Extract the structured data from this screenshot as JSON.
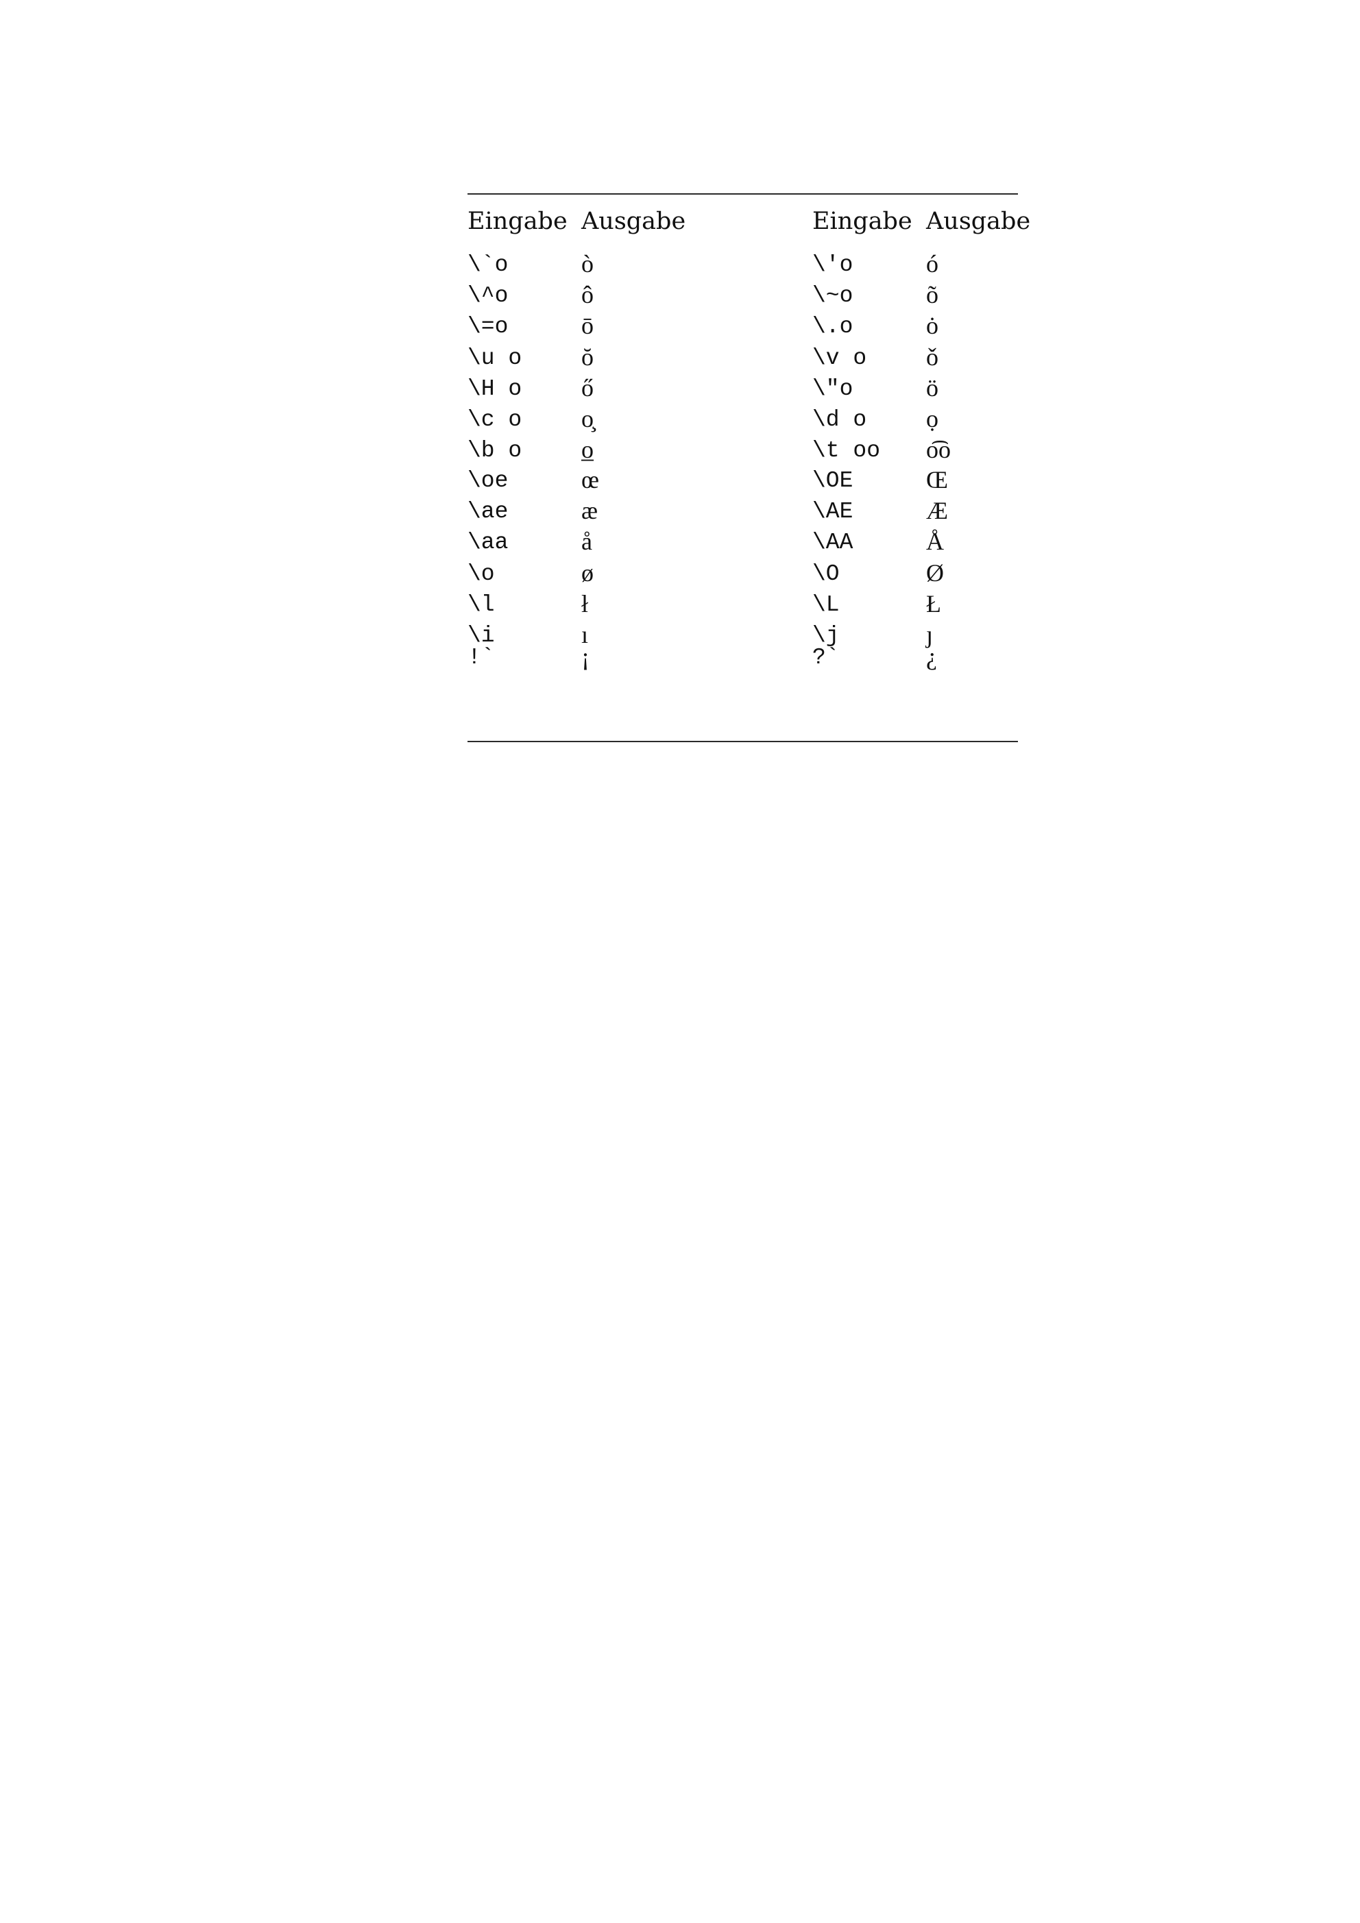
{
  "table": {
    "headers": [
      "Eingabe",
      "Ausgabe",
      "Eingabe",
      "Ausgabe"
    ],
    "groups": [
      {
        "rows": [
          {
            "in_left": "\\`o",
            "out_left": "ò",
            "in_right": "\\'o",
            "out_right": "ó"
          },
          {
            "in_left": "\\^o",
            "out_left": "ô",
            "in_right": "\\~o",
            "out_right": "õ"
          },
          {
            "in_left": "\\=o",
            "out_left": "ō",
            "in_right": "\\.o",
            "out_right": "ȯ"
          },
          {
            "in_left": "\\u o",
            "out_left": "ŏ",
            "in_right": "\\v o",
            "out_right": "ǒ"
          },
          {
            "in_left": "\\H o",
            "out_left": "ő",
            "in_right": "\\\"o",
            "out_right": "ö"
          },
          {
            "in_left": "\\c o",
            "out_left": "o̧",
            "in_right": "\\d o",
            "out_right": "ọ"
          },
          {
            "in_left": "\\b o",
            "out_left": "o̲",
            "in_right": "\\t oo",
            "out_right": "o͡o"
          }
        ]
      },
      {
        "rows": [
          {
            "in_left": "\\oe",
            "out_left": "œ",
            "in_right": "\\OE",
            "out_right": "Œ"
          },
          {
            "in_left": "\\ae",
            "out_left": "æ",
            "in_right": "\\AE",
            "out_right": "Æ"
          },
          {
            "in_left": "\\aa",
            "out_left": "å",
            "in_right": "\\AA",
            "out_right": "Å"
          },
          {
            "in_left": "\\o",
            "out_left": "ø",
            "in_right": "\\O",
            "out_right": "Ø"
          },
          {
            "in_left": "\\l",
            "out_left": "ł",
            "in_right": "\\L",
            "out_right": "Ł"
          },
          {
            "in_left": "\\i",
            "out_left": "ı",
            "in_right": "\\j",
            "out_right": "ȷ"
          }
        ]
      },
      {
        "rows": [
          {
            "in_left": "!`",
            "out_left": "¡",
            "in_right": "?`",
            "out_right": "¿"
          }
        ]
      }
    ]
  }
}
